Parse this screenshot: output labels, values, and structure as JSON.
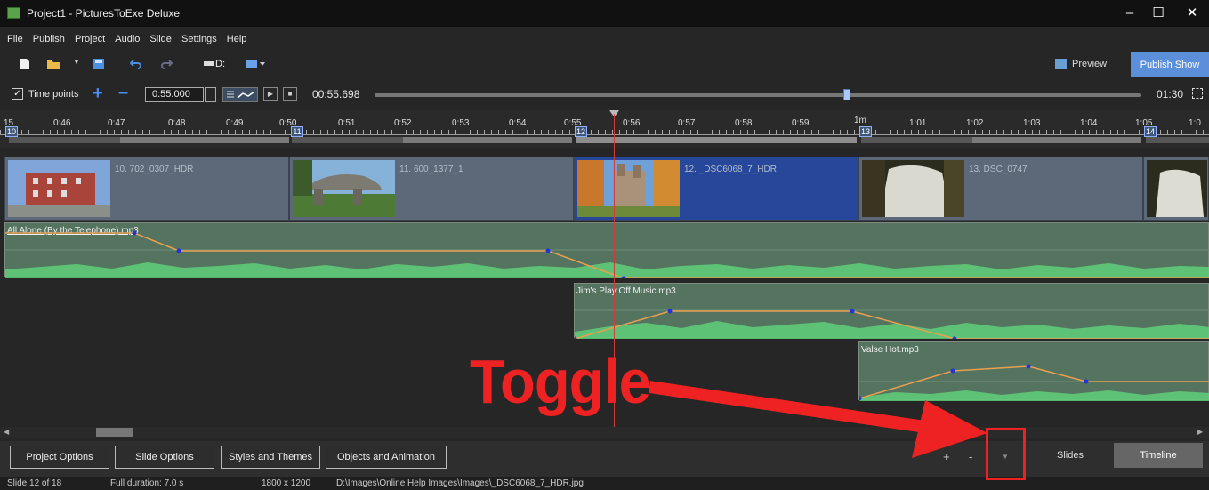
{
  "window": {
    "title": "Project1 - PicturesToExe Deluxe",
    "minimize": "–",
    "maximize": "☐",
    "close": "✕"
  },
  "menu": [
    "File",
    "Publish",
    "Project",
    "Audio",
    "Slide",
    "Settings",
    "Help"
  ],
  "toolbar": {
    "drive_label": "D:",
    "preview_label": "Preview",
    "publish_label": "Publish Show"
  },
  "timepoints": {
    "checkbox_label": "Time points",
    "checked": true,
    "time_value": "0:55.000",
    "current_time": "00:55.698",
    "duration": "01:30",
    "position_fraction": 0.62
  },
  "ruler": {
    "ticks": [
      "15",
      "0:46",
      "0:47",
      "0:48",
      "0:49",
      "0:50",
      "0:51",
      "0:52",
      "0:53",
      "0:54",
      "0:55",
      "0:56",
      "0:57",
      "0:58",
      "0:59",
      "1m",
      "1:01",
      "1:02",
      "1:03",
      "1:04",
      "1:05",
      "1:0"
    ],
    "slide_numbers": [
      "10",
      "11",
      "12",
      "13",
      "14"
    ]
  },
  "slides": [
    {
      "name": "10. 702_0307_HDR",
      "selected": false,
      "icon": "brick-building-thumbnail"
    },
    {
      "name": "11. 600_1377_1",
      "selected": false,
      "icon": "stone-dolmen-thumbnail"
    },
    {
      "name": "12. _DSC6068_7_HDR",
      "selected": true,
      "icon": "castle-autumn-thumbnail"
    },
    {
      "name": "13. DSC_0747",
      "selected": false,
      "icon": "waterfall-thumbnail"
    },
    {
      "name": "",
      "selected": false,
      "icon": "waterfall-thumbnail"
    }
  ],
  "audio_tracks": [
    {
      "name": "All Alone (By the Telephone).mp3",
      "envelope_color": "#e8a050"
    },
    {
      "name": "Jim's Play Off Music.mp3",
      "envelope_color": "#e8a050"
    },
    {
      "name": "Valse Hot.mp3",
      "envelope_color": "#e8a050"
    }
  ],
  "bottom": {
    "buttons": [
      "Project Options",
      "Slide Options",
      "Styles and Themes",
      "Objects and Animation"
    ],
    "zoom_in": "+",
    "zoom_out": "-",
    "toggle": "▼",
    "tabs": [
      {
        "label": "Slides",
        "active": false
      },
      {
        "label": "Timeline",
        "active": true
      }
    ]
  },
  "status": {
    "slide": "Slide 12 of 18",
    "duration": "Full duration: 7.0 s",
    "resolution": "1800 x 1200",
    "path": "D:\\Images\\Online Help Images\\Images\\_DSC6068_7_HDR.jpg"
  },
  "annotation": {
    "text": "Toggle",
    "color": "#ee2222"
  }
}
